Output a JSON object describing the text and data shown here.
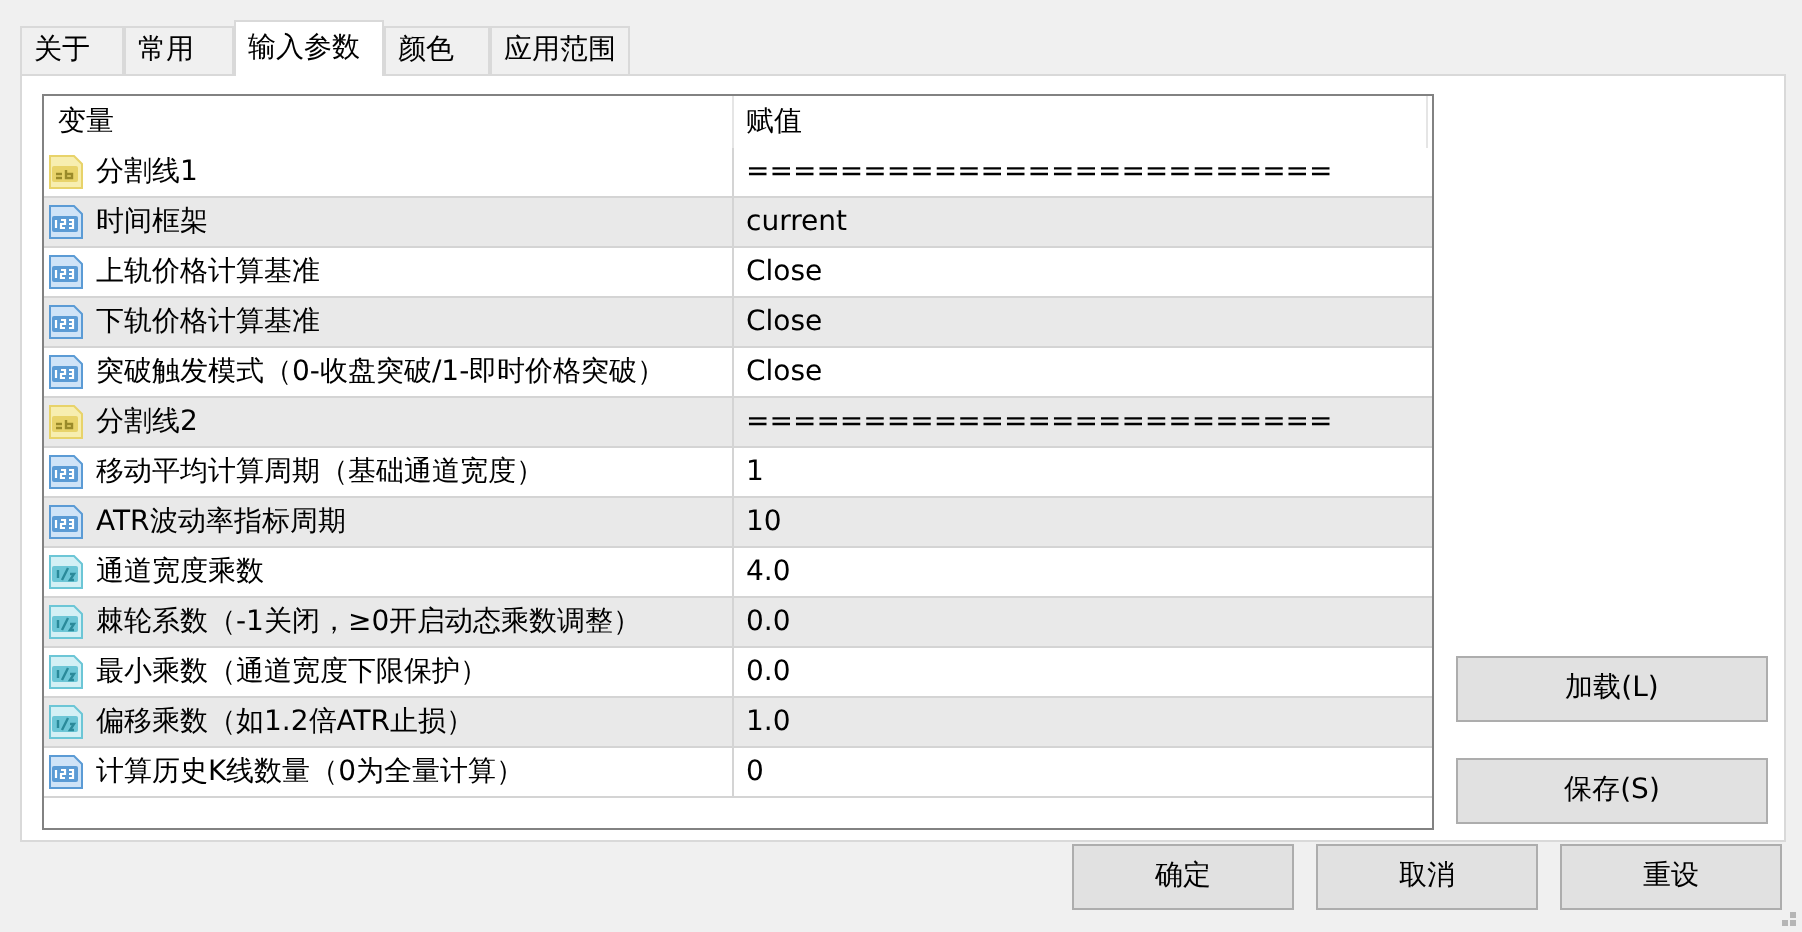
{
  "tabs": [
    {
      "label": "关于",
      "selected": false
    },
    {
      "label": "常用",
      "selected": false
    },
    {
      "label": "输入参数",
      "selected": true
    },
    {
      "label": "颜色",
      "selected": false
    },
    {
      "label": "应用范围",
      "selected": false
    }
  ],
  "table": {
    "columns": [
      "变量",
      "赋值"
    ],
    "rows": [
      {
        "kind": "string",
        "name": "分割线1",
        "value": "========================="
      },
      {
        "kind": "integer",
        "name": "时间框架",
        "value": "current"
      },
      {
        "kind": "integer",
        "name": "上轨价格计算基准",
        "value": "Close"
      },
      {
        "kind": "integer",
        "name": "下轨价格计算基准",
        "value": "Close"
      },
      {
        "kind": "integer",
        "name": "突破触发模式（0-收盘突破/1-即时价格突破）",
        "value": "Close"
      },
      {
        "kind": "string",
        "name": "分割线2",
        "value": "========================="
      },
      {
        "kind": "integer",
        "name": "移动平均计算周期（基础通道宽度）",
        "value": "1"
      },
      {
        "kind": "integer",
        "name": "ATR波动率指标周期",
        "value": "10"
      },
      {
        "kind": "double",
        "name": "通道宽度乘数",
        "value": "4.0"
      },
      {
        "kind": "double",
        "name": "棘轮系数（-1关闭，≥0开启动态乘数调整）",
        "value": "0.0"
      },
      {
        "kind": "double",
        "name": "最小乘数（通道宽度下限保护）",
        "value": "0.0"
      },
      {
        "kind": "double",
        "name": "偏移乘数（如1.2倍ATR止损）",
        "value": "1.0"
      },
      {
        "kind": "integer",
        "name": "计算历史K线数量（0为全量计算）",
        "value": "0"
      }
    ]
  },
  "side_buttons": [
    "加载(L)",
    "保存(S)"
  ],
  "buttons": [
    "确定",
    "取消",
    "重设"
  ]
}
